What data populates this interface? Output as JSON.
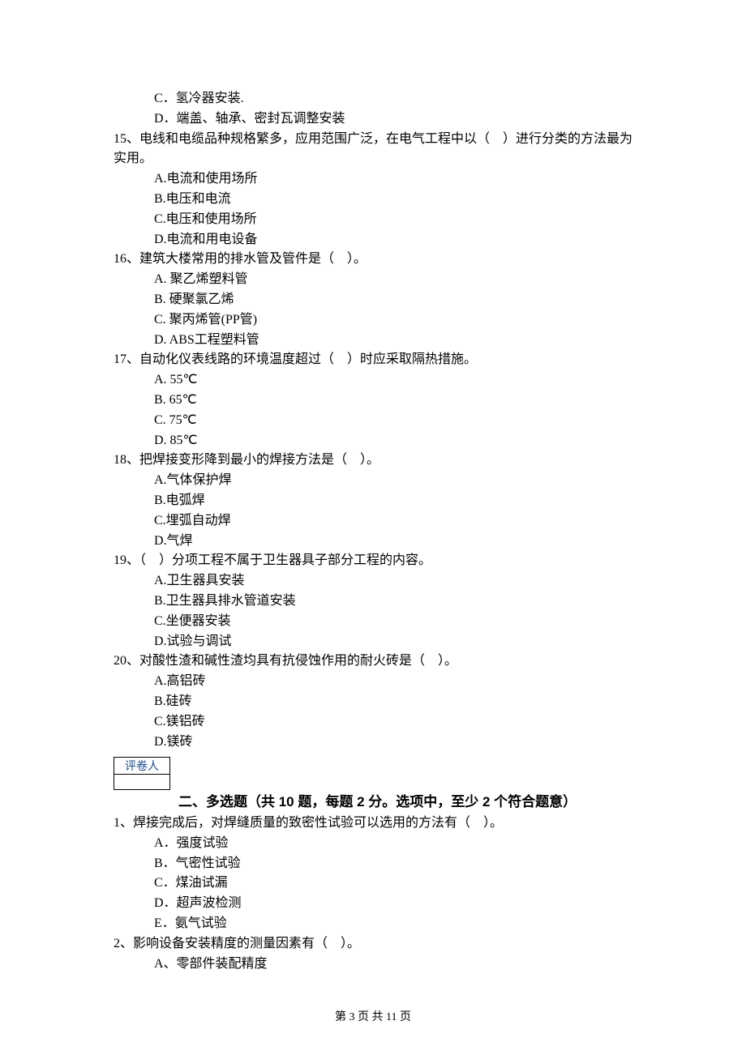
{
  "q14_tail": {
    "c": "C．氢冷器安装.",
    "d": "D．端盖、轴承、密封瓦调整安装"
  },
  "q15": {
    "stem": "15、电线和电缆品种规格繁多，应用范围广泛，在电气工程中以（    ）进行分类的方法最为实用。",
    "a": "A.电流和使用场所",
    "b": "B.电压和电流",
    "c": "C.电压和使用场所",
    "d": "D.电流和用电设备"
  },
  "q16": {
    "stem": "16、建筑大楼常用的排水管及管件是（    ）。",
    "a": "A. 聚乙烯塑料管",
    "b": "B. 硬聚氯乙烯",
    "c": "C. 聚丙烯管(PP管)",
    "d": "D. ABS工程塑料管"
  },
  "q17": {
    "stem": "17、自动化仪表线路的环境温度超过（    ）时应采取隔热措施。",
    "a": "A. 55℃",
    "b": "B. 65℃",
    "c": "C. 75℃",
    "d": "D. 85℃"
  },
  "q18": {
    "stem": "18、把焊接变形降到最小的焊接方法是（    ）。",
    "a": "A.气体保护焊",
    "b": "B.电弧焊",
    "c": "C.埋弧自动焊",
    "d": "D.气焊"
  },
  "q19": {
    "stem": "19、（    ）分项工程不属于卫生器具子部分工程的内容。",
    "a": "A.卫生器具安装",
    "b": "B.卫生器具排水管道安装",
    "c": "C.坐便器安装",
    "d": "D.试验与调试"
  },
  "q20": {
    "stem": "20、对酸性渣和碱性渣均具有抗侵蚀作用的耐火砖是（    ）。",
    "a": "A.高铝砖",
    "b": "B.硅砖",
    "c": "C.镁铝砖",
    "d": "D.镁砖"
  },
  "grader_label": "评卷人",
  "section2_title": "二、多选题（共 10 题，每题 2 分。选项中，至少 2 个符合题意）",
  "mq1": {
    "stem": "1、焊接完成后，对焊缝质量的致密性试验可以选用的方法有（    ）。",
    "a": "A．强度试验",
    "b": "B．气密性试验",
    "c": "C．煤油试漏",
    "d": "D．超声波检测",
    "e": "E．氨气试验"
  },
  "mq2": {
    "stem": "2、影响设备安装精度的测量因素有（    ）。",
    "a": "A、零部件装配精度"
  },
  "footer": "第 3 页 共 11 页"
}
